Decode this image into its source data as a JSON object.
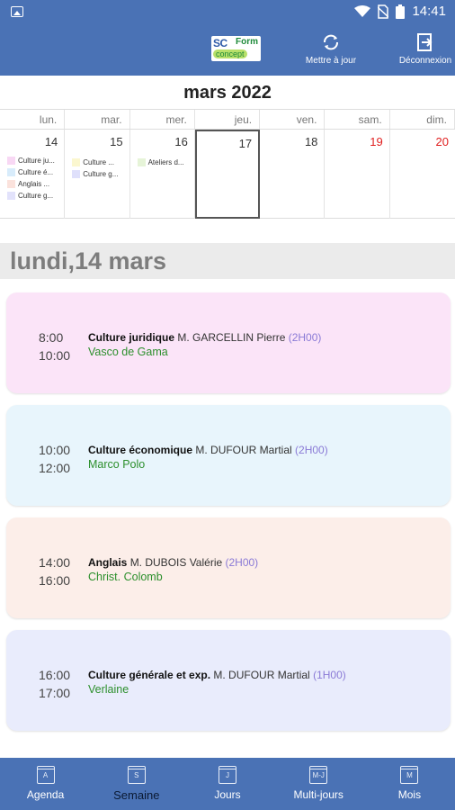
{
  "status_bar": {
    "time": "14:41"
  },
  "app_bar": {
    "logo": {
      "line1": "SC",
      "line2": "Form",
      "line3": "concept"
    },
    "refresh_label": "Mettre à jour",
    "logout_label": "Déconnexion"
  },
  "calendar": {
    "title": "mars 2022",
    "weekdays": [
      "lun.",
      "mar.",
      "mer.",
      "jeu.",
      "ven.",
      "sam.",
      "dim."
    ],
    "days": [
      {
        "num": "14",
        "events": [
          {
            "label": "Culture ju...",
            "color": "#f8d8f4"
          },
          {
            "label": "Culture é...",
            "color": "#d8ecfb"
          },
          {
            "label": "Anglais ...",
            "color": "#fbe2dc"
          },
          {
            "label": "Culture g...",
            "color": "#e2e2fb"
          }
        ]
      },
      {
        "num": "15",
        "events": [
          {
            "label": "Culture ...",
            "color": "#fbf7cf"
          },
          {
            "label": "Culture g...",
            "color": "#dfe0fb"
          }
        ]
      },
      {
        "num": "16",
        "events": [
          {
            "label": "Ateliers d...",
            "color": "#e6f4d8"
          }
        ]
      },
      {
        "num": "17",
        "events": []
      },
      {
        "num": "18",
        "events": []
      },
      {
        "num": "19",
        "events": []
      },
      {
        "num": "20",
        "events": []
      }
    ]
  },
  "selected_day": {
    "heading": "lundi,14 mars"
  },
  "events": [
    {
      "start": "8:00",
      "end": "10:00",
      "subject": "Culture juridique",
      "teacher": "M. GARCELLIN Pierre",
      "duration": "(2H00)",
      "room": "Vasco de Gama",
      "color": "#fbe4f8"
    },
    {
      "start": "10:00",
      "end": "12:00",
      "subject": "Culture économique",
      "teacher": "M. DUFOUR Martial",
      "duration": "(2H00)",
      "room": "Marco Polo",
      "color": "#e8f5fc"
    },
    {
      "start": "14:00",
      "end": "16:00",
      "subject": "Anglais",
      "teacher": "M. DUBOIS Valérie",
      "duration": "(2H00)",
      "room": "Christ. Colomb",
      "color": "#fceee9"
    },
    {
      "start": "16:00",
      "end": "17:00",
      "subject": "Culture générale et exp.",
      "teacher": "M. DUFOUR Martial",
      "duration": "(1H00)",
      "room": "Verlaine",
      "color": "#e9ecfc"
    }
  ],
  "bottom_nav": [
    {
      "icon_letter": "A",
      "label": "Agenda"
    },
    {
      "icon_letter": "S",
      "label": "Semaine"
    },
    {
      "icon_letter": "J",
      "label": "Jours"
    },
    {
      "icon_letter": "M-J",
      "label": "Multi-jours"
    },
    {
      "icon_letter": "M",
      "label": "Mois"
    }
  ],
  "colors": {
    "primary": "#4a72b5",
    "weekend": "#e02020",
    "room": "#2c8f2c",
    "duration": "#8a7ad6"
  }
}
